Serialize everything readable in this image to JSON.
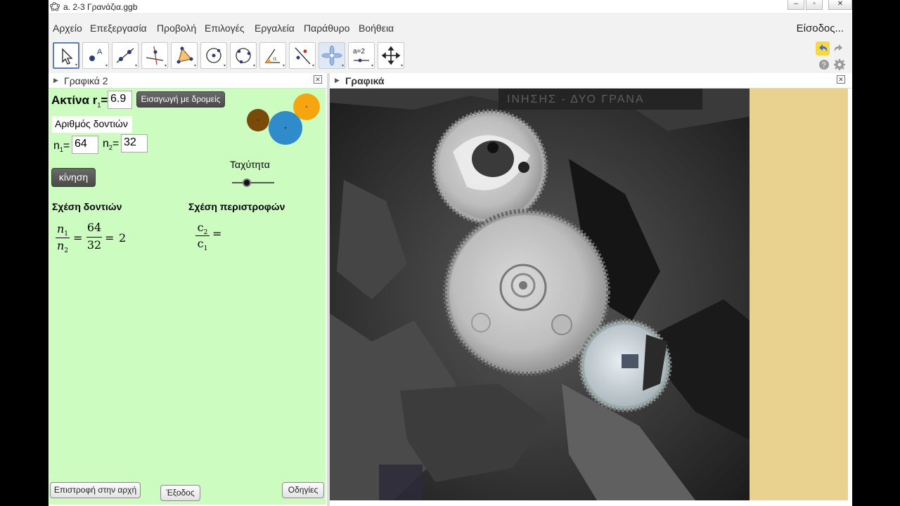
{
  "window": {
    "title": "a. 2-3 Γρανάζια.ggb",
    "controls": [
      "–",
      "▫",
      "✕"
    ]
  },
  "menu": {
    "items": [
      "Αρχείο",
      "Επεξεργασία",
      "Προβολή",
      "Επιλογές",
      "Εργαλεία",
      "Παράθυρο",
      "Βοήθεια"
    ],
    "signin": "Είσοδος..."
  },
  "toolbar": {
    "tools": [
      "move-tool",
      "point-tool",
      "line-tool",
      "perpendicular-tool",
      "polygon-tool",
      "circle-tool",
      "circle-three-points-tool",
      "angle-tool",
      "reflect-tool",
      "slider-star-tool",
      "text-tool",
      "move-graphics-view-tool"
    ],
    "text_tool_label": "a=2"
  },
  "graphics2": {
    "header": "Γραφικά 2",
    "radius_label": "Ακτίνα r",
    "radius_sub": "1",
    "radius_eq": "=",
    "radius_value": "6.9",
    "slider_button": "Εισαγωγή με δρομείς",
    "teeth_title": "Αριθμός δοντιών",
    "n1_label": "n",
    "n1_sub": "1",
    "n1_eq": "=",
    "n1_value": "64",
    "n2_label": "n",
    "n2_sub": "2",
    "n2_eq": "=",
    "n2_value": "32",
    "motion_button": "κίνηση",
    "speed_label": "Ταχύτητα",
    "speed_value": 0.35,
    "teeth_relation_title": "Σχέση δοντιών",
    "rotation_relation_title": "Σχέση περιστροφών",
    "teeth_formula": {
      "num_var": "n",
      "num_sub": "1",
      "den_var": "n",
      "den_sub": "2",
      "eq1": "=",
      "mid_num": "64",
      "mid_den": "32",
      "eq2": "=",
      "result": "2"
    },
    "rotation_formula": {
      "num_var": "c",
      "num_sub": "2",
      "den_var": "c",
      "den_sub": "1",
      "eq": "="
    },
    "back_button": "Επιστροφή στην αρχή",
    "exit_button": "Έξοδος",
    "help_button": "Οδηγίες",
    "gear_colors": [
      "#7a4a08",
      "#2f8bc9",
      "#f5a60f"
    ]
  },
  "graphics": {
    "header": "Γραφικά",
    "photo_caption_fragment": "ΙΝΗΣΗΣ - ΔΥΟ ΓΡΑΝΑ"
  }
}
